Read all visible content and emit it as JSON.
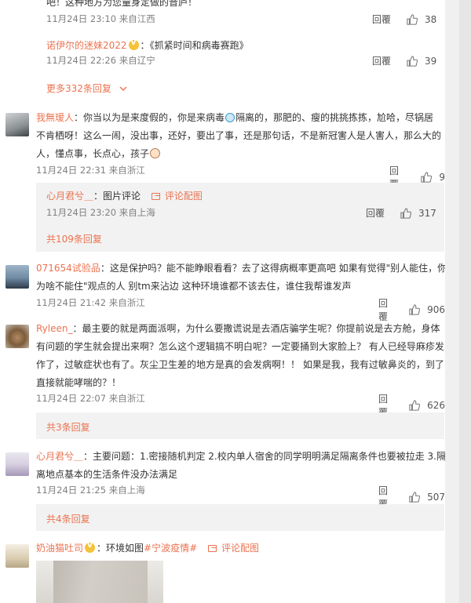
{
  "top_thread": {
    "tail_text": "吧！这种地方为您量身定做的音庐！",
    "tail_meta": "11月24日 23:10 来自江西",
    "tail_likes": "38",
    "reply": {
      "user": "诺伊尔的迷妹2022",
      "colon": "：",
      "text": "《抓紧时间和病毒赛跑》",
      "meta": "11月24日 22:26 来自辽宁",
      "likes": "39"
    },
    "more": "更多332条回复"
  },
  "comments": [
    {
      "user": "我無瑷人",
      "lines": [
        "：你当以为是来度假的，你是来病毒",
        "隔离的，那肥的、瘦的挑挑拣拣，尬哈，尽锅居",
        "不肯栖呀！这么一闹，没出事，还好，要出了事，还是那句话，不是新冠害人是人害人，那么大的",
        "人，懂点事，长点心，孩子"
      ],
      "meta": "11月24日 22:31 来自浙江",
      "likes": "9",
      "sub": {
        "user": "心月君兮＿",
        "text": "：图片评论",
        "pic_link": "评论配图",
        "meta": "11月24日 23:20 来自上海",
        "likes": "317",
        "more": "共109条回复"
      }
    },
    {
      "user": "071654试验品",
      "lines": [
        "：这是保护吗？能不能睁眼看看？去了这得病概率更高吧 如果有觉得\"别人能住，你",
        "为啥不能住\"观点的人 别tm来沾边 这种环境谁都不该去住，谁住我帮谁发声"
      ],
      "meta": "11月24日 21:42 来自浙江",
      "likes": "906"
    },
    {
      "user": "Ryleen_",
      "lines": [
        "：最主要的就是两面派啊，为什么要撒谎说是去酒店骗学生呢？你提前说是去方舱，身体",
        "有问题的学生就会提出来啊？怎么这个逻辑搞不明白呢？一定要捅到大家脸上？ 有人已经导麻疹发",
        "作了，过敏症状也有了。灰尘卫生差的地方是真的会发病啊！！ 如果是我，我有过敏鼻炎的，到了",
        "直接就能哮喘的？！"
      ],
      "meta": "11月24日 22:07 来自浙江",
      "likes": "626",
      "more": "共3条回复"
    },
    {
      "user": "心月君兮＿",
      "lines": [
        "：主要问题：1.密接随机判定 2.校内单人宿舍的同学明明满足隔离条件也要被拉走 3.隔",
        "离地点基本的生活条件没办法满足"
      ],
      "meta": "11月24日 21:25 来自上海",
      "likes": "507",
      "more": "共4条回复"
    },
    {
      "user": "奶油猫吐司",
      "text": "：环境如图",
      "hashtag": "#宁波疫情#",
      "pic_link": "评论配图"
    }
  ],
  "labels": {
    "reply": "回覆"
  },
  "colors": {
    "accent": "#eb7350",
    "meta": "#808080",
    "sub_bg": "#f2f2f2"
  },
  "icons": [
    "thumb-up-icon",
    "chevron-down-icon",
    "image-icon",
    "vip-badge-icon",
    "mask-emoji-icon",
    "baby-emoji-icon"
  ]
}
